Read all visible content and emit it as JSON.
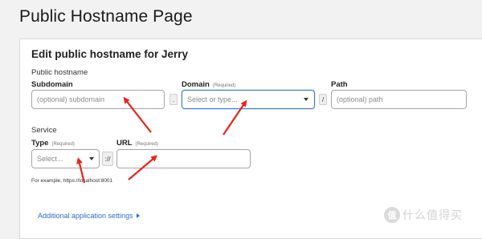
{
  "page": {
    "title": "Public Hostname Page"
  },
  "form": {
    "title": "Edit public hostname for Jerry",
    "public_hostname_label": "Public hostname",
    "subdomain": {
      "label": "Subdomain",
      "placeholder": "(optional) subdomain"
    },
    "dot_separator": ".",
    "domain": {
      "label": "Domain",
      "required": "(Required)",
      "placeholder": "Select or type..."
    },
    "slash_separator": "/",
    "path": {
      "label": "Path",
      "placeholder": "(optional) path"
    },
    "service_label": "Service",
    "type": {
      "label": "Type",
      "required": "(Required)",
      "placeholder": "Select..."
    },
    "scheme_separator": "://",
    "url": {
      "label": "URL",
      "required": "(Required)",
      "value": ""
    },
    "example_hint": "For example, https://localhost:8001",
    "additional_settings_link": "Additional application settings"
  },
  "annotations": {
    "arrow_color": "#e8231b",
    "arrow_count": 4
  },
  "watermark": {
    "text": "什么值得买",
    "logo_glyph": "值"
  }
}
